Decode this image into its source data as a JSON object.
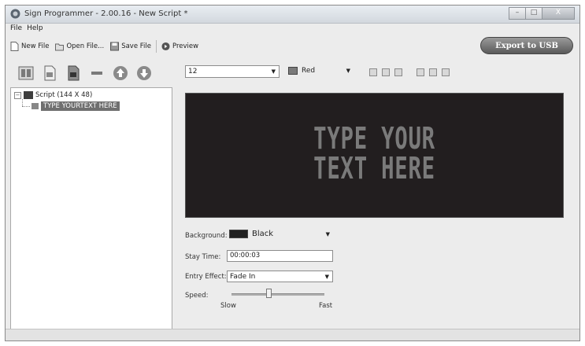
{
  "window": {
    "title": "Sign Programmer - 2.00.16 - New Script *",
    "minimize": "–",
    "maximize": "□",
    "close": "X"
  },
  "menu": {
    "file": "File",
    "help": "Help"
  },
  "toolbar": {
    "new_file": "New File",
    "open_file": "Open File...",
    "save_file": "Save File",
    "preview": "Preview",
    "export": "Export to USB"
  },
  "tree": {
    "root_label": "Script (144 X 48)",
    "child_label": "TYPE YOURTEXT HERE",
    "expander": "−"
  },
  "format": {
    "font_size": "12",
    "color_name": "Red",
    "color_hex": "#7a7a7a"
  },
  "preview": {
    "line1": "TYPE YOUR",
    "line2": "TEXT HERE",
    "bg_color": "#221e1f",
    "text_color": "#7a7a7a"
  },
  "settings": {
    "background_label": "Background:",
    "background_value": "Black",
    "background_hex": "#222222",
    "stay_time_label": "Stay Time:",
    "stay_time_value": "00:00:03",
    "entry_effect_label": "Entry Effect:",
    "entry_effect_value": "Fade In",
    "speed_label": "Speed:",
    "speed_slow": "Slow",
    "speed_fast": "Fast",
    "speed_level": 0.4
  },
  "icons": [
    "app-icon",
    "new-file-icon",
    "open-folder-icon",
    "save-disk-icon",
    "preview-circle-icon",
    "columns-icon",
    "page-icon",
    "page-dark-icon",
    "minus-icon",
    "arrow-up-icon",
    "arrow-down-icon",
    "align-left-icon",
    "align-center-icon",
    "align-right-icon",
    "align-top-icon",
    "align-middle-icon",
    "align-bottom-icon"
  ]
}
